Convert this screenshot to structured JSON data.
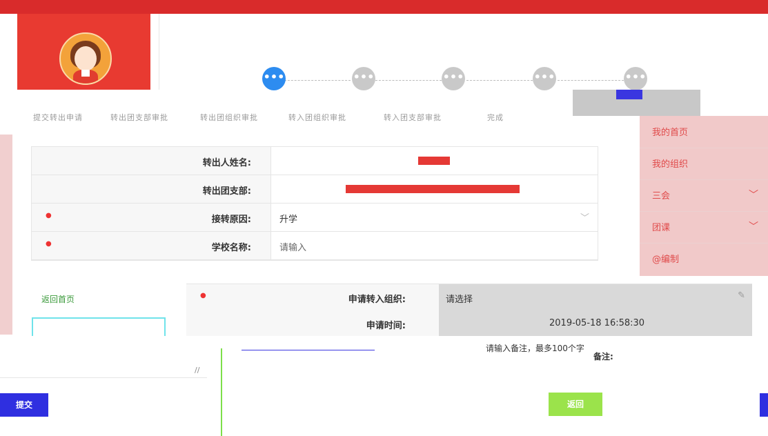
{
  "steps": [
    "•••",
    "•••",
    "•••",
    "•••",
    "•••"
  ],
  "step_labels": [
    "提交转出申请",
    "转出团支部审批",
    "转出团组织审批",
    "转入团组织审批",
    "转入团支部审批",
    "完成"
  ],
  "menu": [
    {
      "label": "我的首页",
      "icon": "home-icon",
      "chevron": ""
    },
    {
      "label": "我的组织",
      "icon": "group-icon",
      "chevron": ""
    },
    {
      "label": "三会",
      "icon": "meeting-icon",
      "chevron": "﹀"
    },
    {
      "label": "团课",
      "icon": "folder-icon",
      "chevron": "﹀"
    },
    {
      "label": "@编制",
      "icon": "",
      "chevron": ""
    }
  ],
  "form": {
    "rows": [
      {
        "label": "转出人姓名:",
        "required": false,
        "value": "",
        "redacted": true
      },
      {
        "label": "转出团支部:",
        "required": false,
        "value": "",
        "redacted": true
      },
      {
        "label": "接转原因:",
        "required": true,
        "value": "升学",
        "select": true
      },
      {
        "label": "学校名称:",
        "required": true,
        "value": "请输入"
      }
    ]
  },
  "overlay": {
    "row1_label": "申请转入组织:",
    "row1_value": "请选择",
    "row2_label": "申请时间:",
    "row2_value": "2019-05-18 16:58:30"
  },
  "left_panel": {
    "green_label": "返回首页"
  },
  "remark": {
    "hint": "请输入备注，最多100个字",
    "label": "备注:",
    "grip": "//"
  },
  "buttons": {
    "submit": "提交",
    "back": "返回"
  },
  "colors": {
    "brand_red": "#d92b2b",
    "step_active": "#2d8cf0",
    "submit_blue": "#2f2fe0",
    "back_green": "#9be34b"
  }
}
